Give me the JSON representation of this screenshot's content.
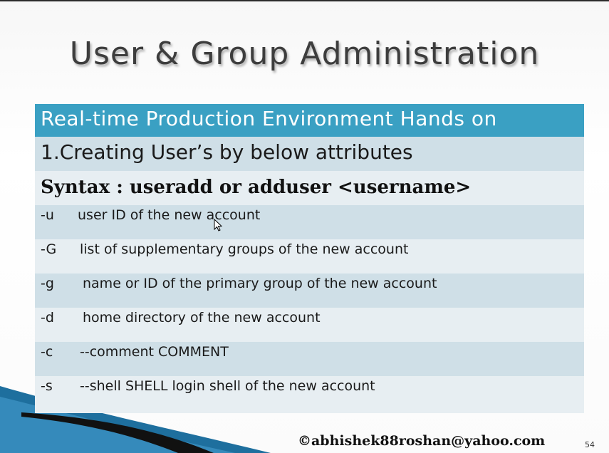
{
  "slide": {
    "title": "User & Group Administration",
    "header_row": "Real-time  Production Environment  Hands on",
    "subtitle_row": "1.Creating User’s by below attributes",
    "syntax_row": "Syntax :  useradd or adduser <username>",
    "options": [
      {
        "flag": "-u",
        "desc": "user ID of the new account"
      },
      {
        "flag": "-G",
        "desc": "list of supplementary groups of the new account"
      },
      {
        "flag": "-g",
        "desc": "name or ID of the primary group of the new account"
      },
      {
        "flag": "-d",
        "desc": "home directory of the new account"
      },
      {
        "flag": "-c",
        "desc": "--comment COMMENT"
      },
      {
        "flag": "-s",
        "desc": "--shell SHELL  login shell of the new account"
      }
    ],
    "footer": "©abhishek88roshan@yahoo.com",
    "page_number": "54"
  },
  "colors": {
    "header_bg": "#3aa0c3",
    "row_dark": "#cfdfe7",
    "row_light": "#e7eef2",
    "accent_wave": "#1e6f9e"
  }
}
